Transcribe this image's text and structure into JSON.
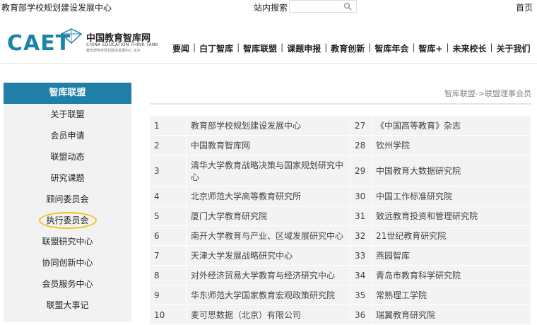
{
  "topbar": {
    "site_name": "教育部学校规划建设发展中心",
    "search_label": "站内搜索",
    "home_link": "首页"
  },
  "logo": {
    "brand_mark": "CAET",
    "cn_name": "中国教育智库网",
    "en_name": "CHINA EDUCATION THINK TANK",
    "sub_text": "教育部学校规划建设发展中心 主办"
  },
  "nav": {
    "items": [
      "要闻",
      "白丁智库",
      "智库联盟",
      "课题申报",
      "教育创新",
      "智库年会",
      "智库+",
      "未来校长",
      "关于我们"
    ]
  },
  "sidebar": {
    "title": "智库联盟",
    "items": [
      "关于联盟",
      "会员申请",
      "联盟动态",
      "研究课题",
      "顾问委员会",
      "执行委员会",
      "联盟研究中心",
      "协同创新中心",
      "会员服务中心",
      "联盟大事记"
    ],
    "highlighted_index": 5
  },
  "breadcrumb": "智库联盟->联盟理事会员",
  "members": [
    {
      "left_no": "1",
      "left_name": "教育部学校规划建设发展中心",
      "right_no": "27",
      "right_name": "《中国高等教育》杂志"
    },
    {
      "left_no": "2",
      "left_name": "中国教育智库网",
      "right_no": "28",
      "right_name": "钦州学院"
    },
    {
      "left_no": "3",
      "left_name": "清华大学教育战略决策与国家规划研究中心",
      "right_no": "29",
      "right_name": "中国教育大数据研究院"
    },
    {
      "left_no": "4",
      "left_name": "北京师范大学高等教育研究所",
      "right_no": "30",
      "right_name": "中国工作标准研究院"
    },
    {
      "left_no": "5",
      "left_name": "厦门大学教育研究院",
      "right_no": "31",
      "right_name": "致远教育投资和管理研究院"
    },
    {
      "left_no": "6",
      "left_name": "南开大学教育与产业、区域发展研究中心",
      "right_no": "32",
      "right_name": "21世纪教育研究院"
    },
    {
      "left_no": "7",
      "left_name": "天津大学发展战略研究中心",
      "right_no": "33",
      "right_name": "燕园智库"
    },
    {
      "left_no": "8",
      "left_name": "对外经济贸易大学教育与经济研究中心",
      "right_no": "34",
      "right_name": "青岛市教育科学研究院"
    },
    {
      "left_no": "9",
      "left_name": "华东师范大学国家教育宏观政策研究院",
      "right_no": "35",
      "right_name": "常熟理工学院"
    },
    {
      "left_no": "10",
      "left_name": "麦可思数据（北京）有限公司",
      "right_no": "36",
      "right_name": "瑞翼教育研究院"
    }
  ],
  "colors": {
    "brand_blue": "#1f7fa6",
    "highlight_ring": "#f0c419"
  }
}
